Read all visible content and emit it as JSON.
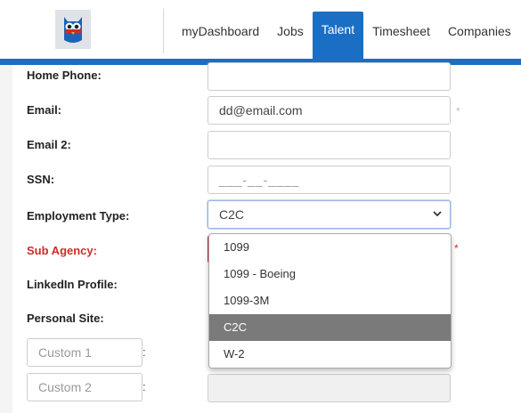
{
  "nav": {
    "items": [
      "myDashboard",
      "Jobs",
      "Talent",
      "Timesheet",
      "Companies"
    ],
    "active": "Talent"
  },
  "form": {
    "home_phone_label": "Home Phone:",
    "email_label": "Email:",
    "email_value": "dd@email.com",
    "email2_label": "Email 2:",
    "ssn_label": "SSN:",
    "ssn_placeholder": "___-__-____",
    "employment_type_label": "Employment Type:",
    "employment_type_value": "C2C",
    "sub_agency_label": "Sub Agency:",
    "linkedin_label": "LinkedIn Profile:",
    "personal_site_label": "Personal Site:",
    "custom1_placeholder": "Custom 1",
    "custom2_placeholder": "Custom 2",
    "colon": ":",
    "required_marker": "*"
  },
  "dropdown": {
    "options": [
      "1099",
      "1099 - Boeing",
      "1099-3M",
      "C2C",
      "W-2"
    ],
    "selected": "C2C"
  },
  "colors": {
    "accent": "#1a6fc4",
    "required": "#d12a2a"
  },
  "icons": {
    "logo": "owl-logo-icon",
    "select_chevron": "chevron-down-icon"
  }
}
